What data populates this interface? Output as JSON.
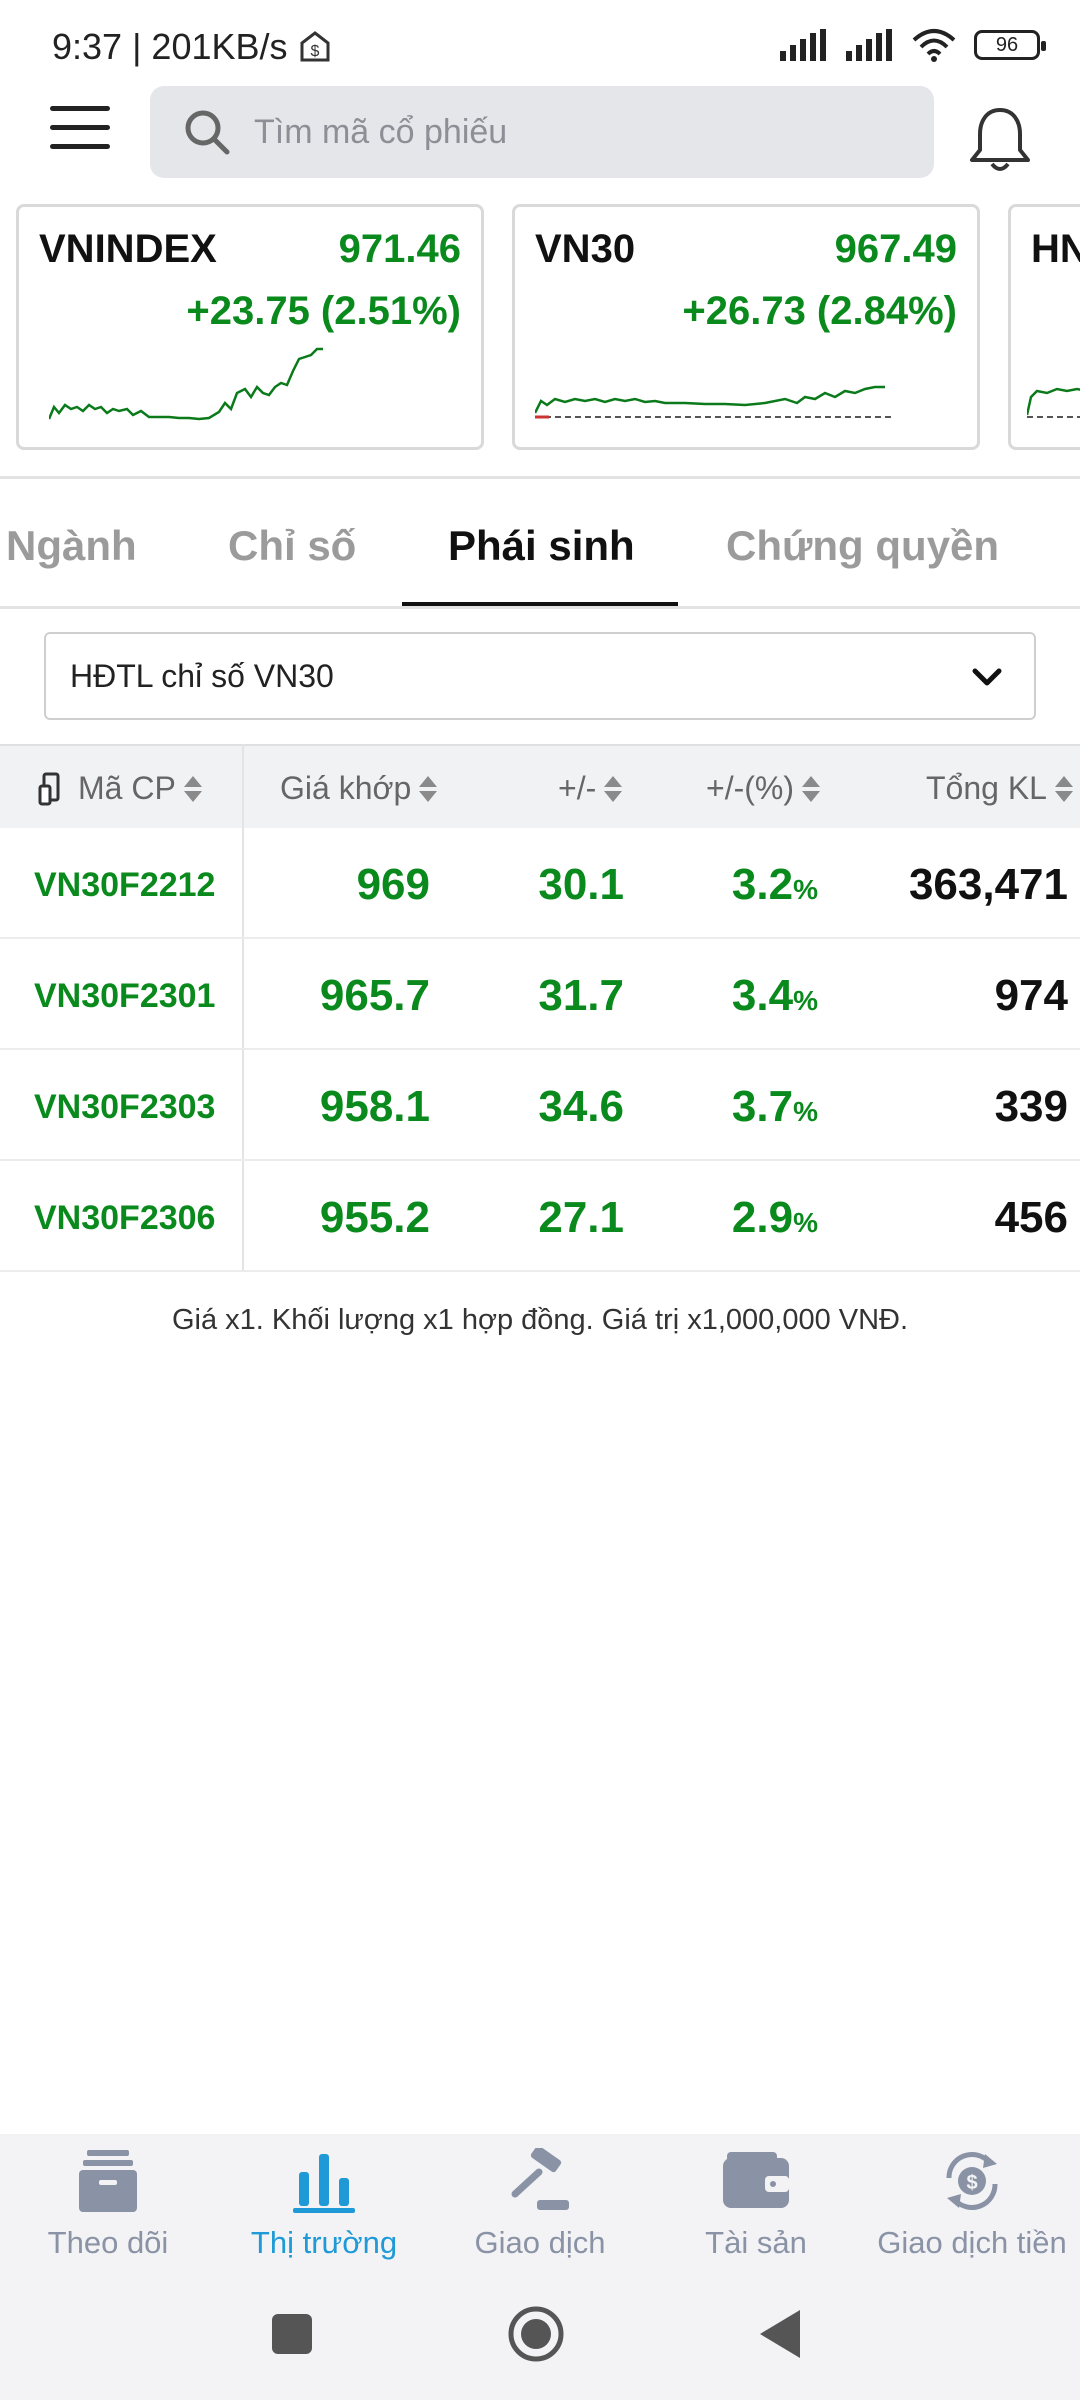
{
  "status_bar": {
    "time_speed": "9:37 | 201KB/s",
    "battery": "96"
  },
  "search": {
    "placeholder": "Tìm mã cổ phiếu"
  },
  "indices": [
    {
      "name": "VNINDEX",
      "value": "971.46",
      "change": "+23.75 (2.51%)"
    },
    {
      "name": "VN30",
      "value": "967.49",
      "change": "+26.73 (2.84%)"
    },
    {
      "name": "HN",
      "value": "",
      "change": ""
    }
  ],
  "tabs": [
    {
      "label": "Ngành"
    },
    {
      "label": "Chỉ số"
    },
    {
      "label": "Phái sinh"
    },
    {
      "label": "Chứng quyền"
    }
  ],
  "dropdown": {
    "selected": "HĐTL chỉ số VN30"
  },
  "table": {
    "headers": [
      "Mã CP",
      "Giá khớp",
      "+/-",
      "+/-(%)",
      "Tổng KL"
    ],
    "rows": [
      {
        "symbol": "VN30F2212",
        "price": "969",
        "change": "30.1",
        "pct": "3.2",
        "volume": "363,471"
      },
      {
        "symbol": "VN30F2301",
        "price": "965.7",
        "change": "31.7",
        "pct": "3.4",
        "volume": "974"
      },
      {
        "symbol": "VN30F2303",
        "price": "958.1",
        "change": "34.6",
        "pct": "3.7",
        "volume": "339"
      },
      {
        "symbol": "VN30F2306",
        "price": "955.2",
        "change": "27.1",
        "pct": "2.9",
        "volume": "456"
      }
    ],
    "pct_unit": "%"
  },
  "footnote": "Giá x1. Khối lượng x1 hợp đồng. Giá trị x1,000,000 VNĐ.",
  "bottom_nav": [
    {
      "label": "Theo dõi",
      "icon": "watchlist-icon"
    },
    {
      "label": "Thị trường",
      "icon": "market-chart-icon"
    },
    {
      "label": "Giao dịch",
      "icon": "gavel-icon"
    },
    {
      "label": "Tài sản",
      "icon": "wallet-icon"
    },
    {
      "label": "Giao dịch tiền",
      "icon": "money-transfer-icon"
    }
  ],
  "colors": {
    "up": "#0a8a1d",
    "active_nav": "#1f9ad6",
    "inactive": "#8a93a6"
  }
}
